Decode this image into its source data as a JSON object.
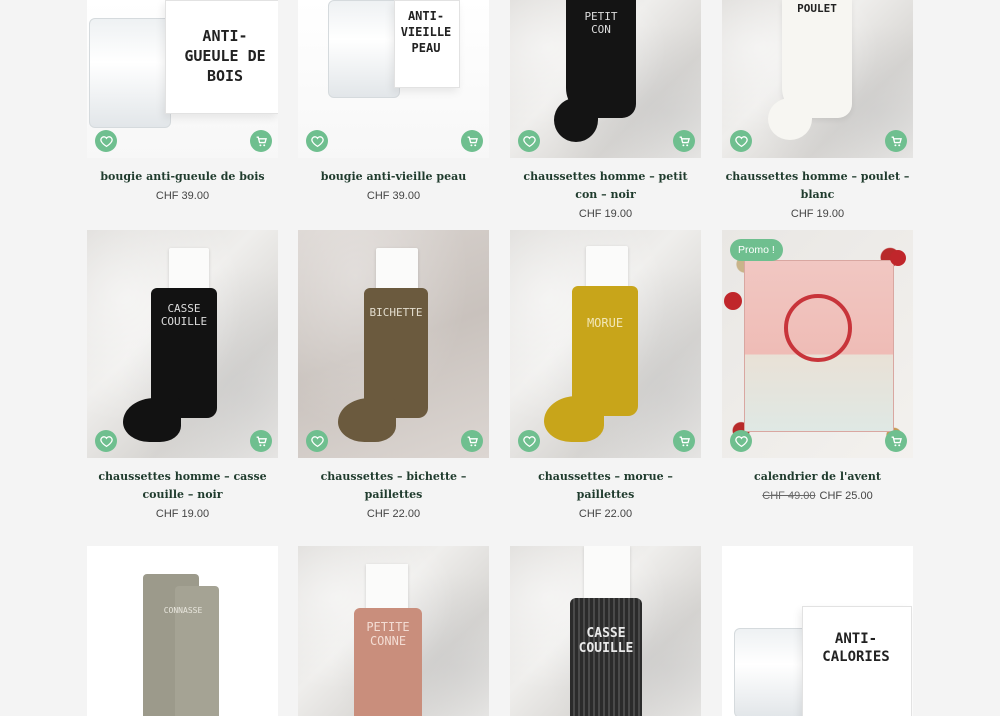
{
  "products": [
    {
      "title": "bougie anti-gueule de bois",
      "price": "CHF 39.00",
      "art_text": "ANTI-\nGUEULE DE BOIS"
    },
    {
      "title": "bougie anti-vieille peau",
      "price": "CHF 39.00",
      "art_text": "ANTI-\nVIEILLE PEAU"
    },
    {
      "title": "chaussettes homme – petit con – noir",
      "price": "CHF 19.00",
      "art_text": "PETIT\nCON"
    },
    {
      "title": "chaussettes homme – poulet – blanc",
      "price": "CHF 19.00",
      "art_text": "POULET"
    },
    {
      "title": "chaussettes homme – casse couille – noir",
      "price": "CHF 19.00",
      "art_text": "CASSE\nCOUILLE"
    },
    {
      "title": "chaussettes – bichette – paillettes",
      "price": "CHF 22.00",
      "art_text": "BICHETTE"
    },
    {
      "title": "chaussettes – morue – paillettes",
      "price": "CHF 22.00",
      "art_text": "MORUE"
    },
    {
      "title": "calendrier de l'avent",
      "old_price": "CHF 49.00",
      "price": "CHF 25.00",
      "badge": "Promo !"
    },
    {
      "title": "",
      "price": "",
      "art_text": "CONNASSE"
    },
    {
      "title": "",
      "price": "",
      "art_text": "PETITE\nCONNE"
    },
    {
      "title": "",
      "price": "",
      "art_text": "CASSE\nCOUILLE"
    },
    {
      "title": "",
      "price": "",
      "art_text": "ANTI-\nCALORIES"
    }
  ],
  "colors": {
    "accent": "#6fbf8f",
    "title_text": "#1f3b2d",
    "background": "#f4f4f4"
  },
  "icons": {
    "favorite": "heart-icon",
    "cart": "cart-icon"
  }
}
